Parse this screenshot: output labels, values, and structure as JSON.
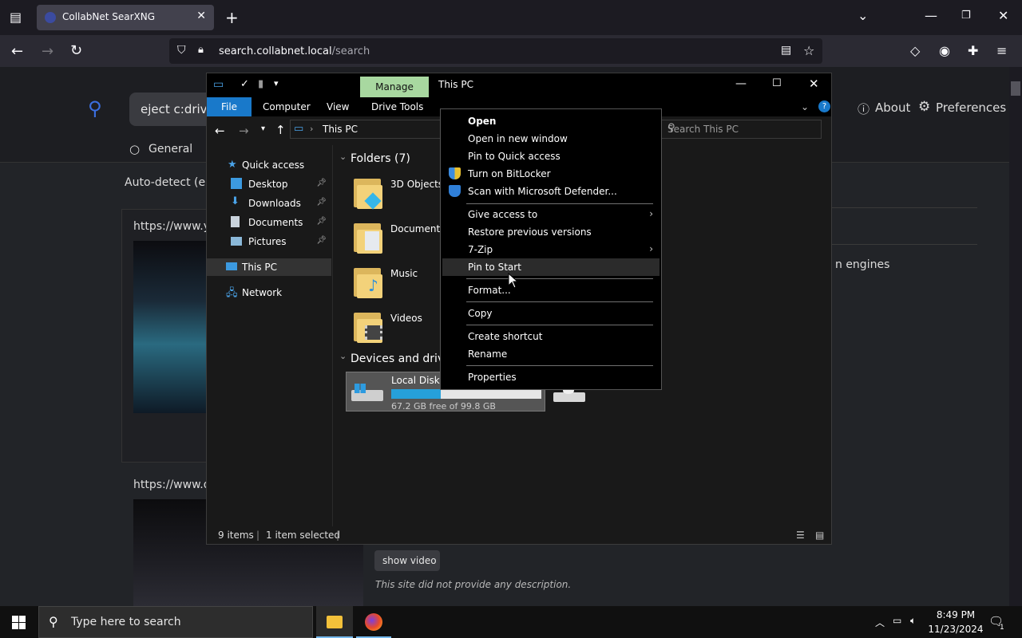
{
  "browser": {
    "tab_title": "CollabNet SearXNG",
    "url_host": "search.collabnet.local",
    "url_path": "/search"
  },
  "searx": {
    "query": "eject c:drive",
    "tab_general": "General",
    "autodetect": "Auto-detect (en-U",
    "about": "About",
    "preferences": "Preferences",
    "result1_url": "https://www.you",
    "result2_url": "https://www.da",
    "engines_text": "n engines",
    "show_video": "show video",
    "no_description": "This site did not provide any description."
  },
  "explorer": {
    "manage_tab": "Manage",
    "window_title": "This PC",
    "ribbon_tabs": [
      "File",
      "Computer",
      "View",
      "Drive Tools"
    ],
    "address": "This PC",
    "search_placeholder": "Search This PC",
    "nav": {
      "quick_access": "Quick access",
      "desktop": "Desktop",
      "downloads": "Downloads",
      "documents": "Documents",
      "pictures": "Pictures",
      "this_pc": "This PC",
      "network": "Network"
    },
    "folders_header": "Folders (7)",
    "folders": [
      "3D Objects",
      "Documents",
      "Music",
      "Videos"
    ],
    "devices_header": "Devices and drive",
    "disk_name": "Local Disk (",
    "disk_free": "67.2 GB free of 99.8 GB",
    "disk_used_fraction": 0.33,
    "status_items": "9 items",
    "status_selected": "1 item selected"
  },
  "context_menu": {
    "open": "Open",
    "open_new_window": "Open in new window",
    "pin_quick_access": "Pin to Quick access",
    "bitlocker": "Turn on BitLocker",
    "defender": "Scan with Microsoft Defender...",
    "give_access": "Give access to",
    "restore": "Restore previous versions",
    "zip": "7-Zip",
    "pin_start": "Pin to Start",
    "format": "Format...",
    "copy": "Copy",
    "create_shortcut": "Create shortcut",
    "rename": "Rename",
    "properties": "Properties"
  },
  "taskbar": {
    "search_placeholder": "Type here to search",
    "time": "8:49 PM",
    "date": "11/23/2024",
    "notification_count": "1"
  },
  "colors": {
    "accent_blue": "#1979ca",
    "manage_green": "#a8d8a0",
    "disk_fill": "#26a0da"
  }
}
